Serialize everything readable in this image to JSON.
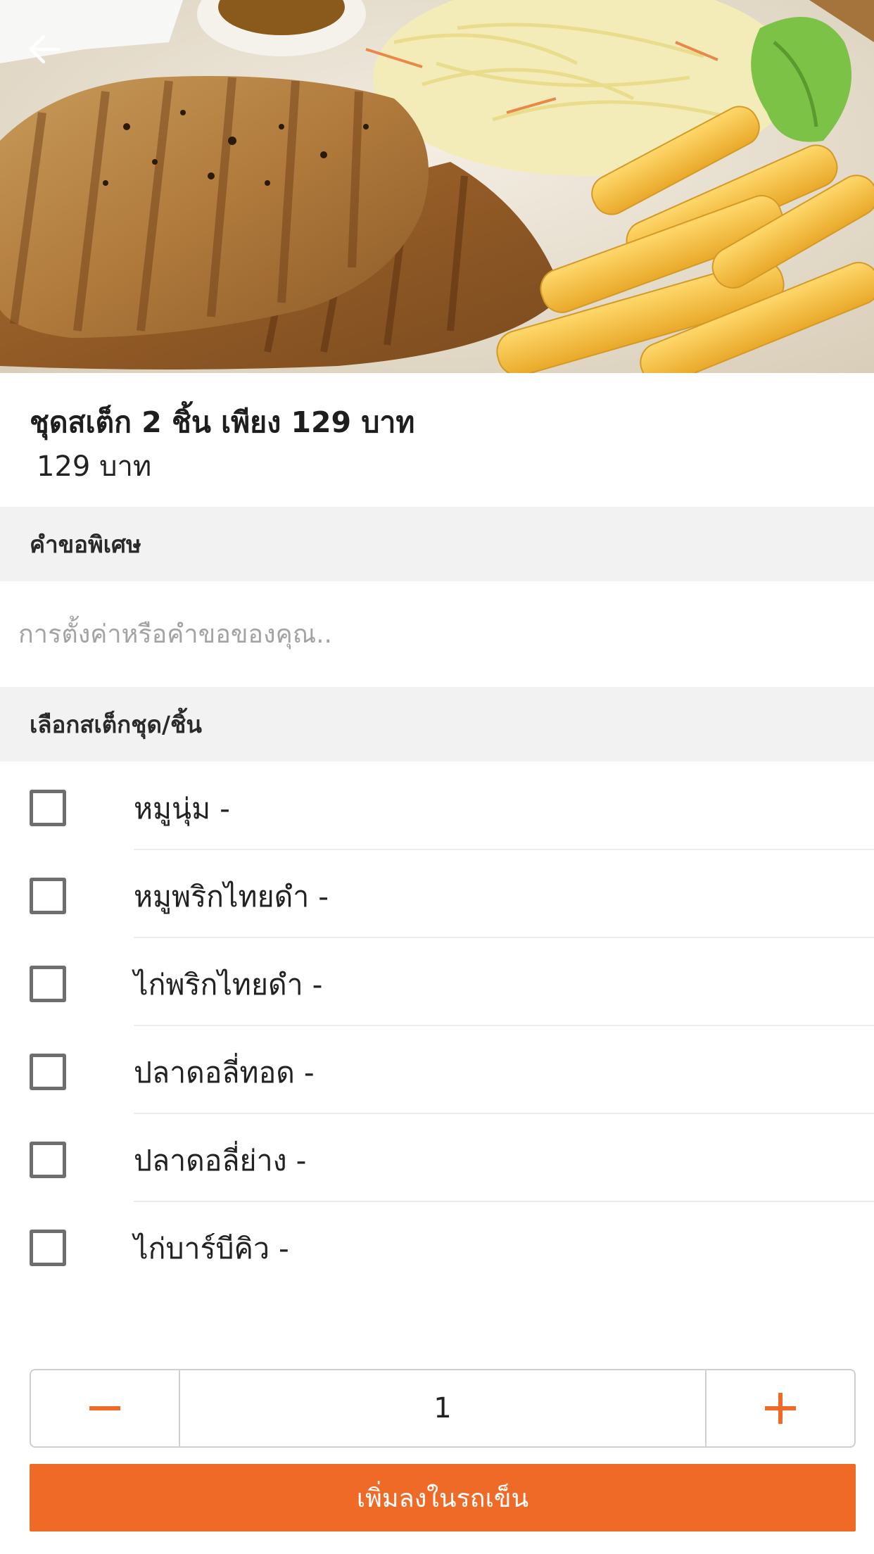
{
  "hero": {
    "image_description_icon": "food-photo",
    "back_icon": "arrow-left-icon"
  },
  "product": {
    "title": "ชุดสเต็ก 2 ชิ้น เพียง 129 บาท",
    "price": "129 บาท"
  },
  "special_request": {
    "header": "คำขอพิเศษ",
    "placeholder": "การตั้งค่าหรือคำขอของคุณ..",
    "value": ""
  },
  "options_section": {
    "header": "เลือกสเต็กชุด/ชิ้น",
    "items": [
      {
        "label": "หมูนุ่ม  -",
        "checked": false
      },
      {
        "label": "หมูพริกไทยดำ  -",
        "checked": false
      },
      {
        "label": "ไก่พริกไทยดำ  -",
        "checked": false
      },
      {
        "label": "ปลาดอลี่ทอด  -",
        "checked": false
      },
      {
        "label": "ปลาดอลี่ย่าง  -",
        "checked": false
      },
      {
        "label": "ไก่บาร์บีคิว  -",
        "checked": false
      }
    ]
  },
  "quantity": {
    "value": "1",
    "minus_icon": "minus-icon",
    "plus_icon": "plus-icon"
  },
  "cart": {
    "add_label": "เพิ่มลงในรถเข็น"
  },
  "colors": {
    "accent": "#ef6a27",
    "section_bg": "#f2f2f2",
    "placeholder": "#a3a3a3"
  }
}
